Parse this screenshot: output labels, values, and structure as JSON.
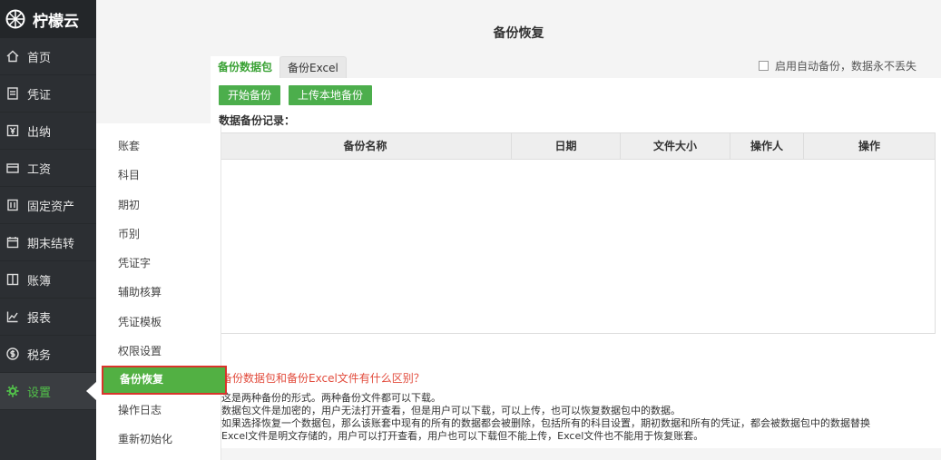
{
  "brand": {
    "name": "柠檬云"
  },
  "nav": [
    {
      "label": "首页",
      "icon": "home-icon"
    },
    {
      "label": "凭证",
      "icon": "document-icon"
    },
    {
      "label": "出纳",
      "icon": "cashier-icon"
    },
    {
      "label": "工资",
      "icon": "card-icon"
    },
    {
      "label": "固定资产",
      "icon": "building-icon"
    },
    {
      "label": "期末结转",
      "icon": "calendar-icon"
    },
    {
      "label": "账簿",
      "icon": "book-icon"
    },
    {
      "label": "报表",
      "icon": "chart-icon"
    },
    {
      "label": "税务",
      "icon": "dollar-icon"
    },
    {
      "label": "设置",
      "icon": "gear-icon",
      "active": true
    }
  ],
  "submenu": [
    {
      "label": "账套"
    },
    {
      "label": "科目"
    },
    {
      "label": "期初"
    },
    {
      "label": "币别"
    },
    {
      "label": "凭证字"
    },
    {
      "label": "辅助核算"
    },
    {
      "label": "凭证模板"
    },
    {
      "label": "权限设置"
    },
    {
      "label": "备份恢复",
      "active": true
    },
    {
      "label": "操作日志"
    },
    {
      "label": "重新初始化"
    }
  ],
  "page": {
    "title": "备份恢复"
  },
  "auto_backup": {
    "label": "启用自动备份，数据永不丢失",
    "checked": false
  },
  "tabs": [
    {
      "label": "备份数据包",
      "active": true
    },
    {
      "label": "备份Excel",
      "active": false
    }
  ],
  "buttons": {
    "start_backup": "开始备份",
    "upload_local": "上传本地备份"
  },
  "records_label": "数据备份记录：",
  "table": {
    "columns": [
      "备份名称",
      "日期",
      "文件大小",
      "操作人",
      "操作"
    ],
    "rows": []
  },
  "faq": {
    "question": "备份数据包和备份Excel文件有什么区别？",
    "lines": [
      "这是两种备份的形式。两种备份文件都可以下载。",
      "数据包文件是加密的，用户无法打开查看，但是用户可以下载，可以上传，也可以恢复数据包中的数据。",
      "如果选择恢复一个数据包，那么该账套中现有的所有的数据都会被删除，包括所有的科目设置，期初数据和所有的凭证，都会被数据包中的数据替换",
      "Excel文件是明文存储的，用户可以打开查看，用户也可以下载但不能上传，Excel文件也不能用于恢复账套。"
    ]
  },
  "colors": {
    "accent": "#52b043",
    "sidebar_bg": "#2c2f33",
    "highlight_border": "#d9342b",
    "faq_question": "#e24b3c"
  }
}
